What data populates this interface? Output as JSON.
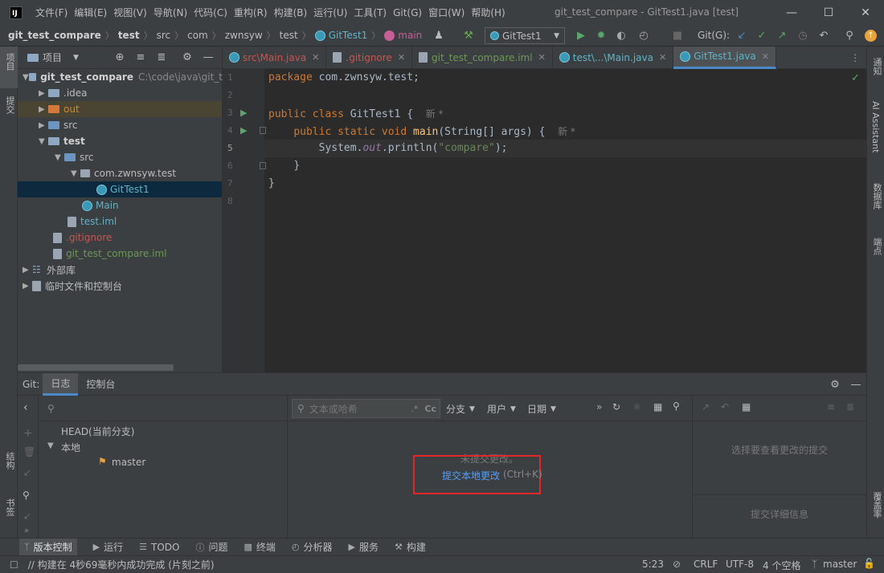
{
  "menu": [
    "文件(F)",
    "编辑(E)",
    "视图(V)",
    "导航(N)",
    "代码(C)",
    "重构(R)",
    "构建(B)",
    "运行(U)",
    "工具(T)",
    "Git(G)",
    "窗口(W)",
    "帮助(H)"
  ],
  "window_title": "git_test_compare - GitTest1.java [test]",
  "breadcrumbs": [
    "git_test_compare",
    "test",
    "src",
    "com",
    "zwnsyw",
    "test",
    "GitTest1",
    "main"
  ],
  "run_config": "GitTest1",
  "git_label": "Git(G):",
  "left_strip": {
    "project": "项目",
    "commit": "提交",
    "structure": "结构",
    "bookmarks": "书签"
  },
  "right_strip": {
    "notifications": "通知",
    "ai": "AI Assistant",
    "database": "数据库",
    "endpoints": "端点",
    "coverage": "覆盖率"
  },
  "project": {
    "header": "项目",
    "root_name": "git_test_compare",
    "root_path": "C:\\code\\java\\git_t",
    "items": [
      {
        "label": ".idea"
      },
      {
        "label": "out"
      },
      {
        "label": "src"
      },
      {
        "label": "test"
      },
      {
        "label": "src"
      },
      {
        "label": "com.zwnsyw.test"
      },
      {
        "label": "GitTest1"
      },
      {
        "label": "Main"
      },
      {
        "label": "test.iml"
      },
      {
        "label": ".gitignore"
      },
      {
        "label": "git_test_compare.iml"
      },
      {
        "label": "外部库"
      },
      {
        "label": "临时文件和控制台"
      }
    ]
  },
  "tabs": [
    {
      "label": "src\\Main.java"
    },
    {
      "label": ".gitignore"
    },
    {
      "label": "git_test_compare.iml"
    },
    {
      "label": "test\\...\\Main.java"
    },
    {
      "label": "GitTest1.java"
    }
  ],
  "code": {
    "line_numbers": [
      "1",
      "2",
      "3",
      "4",
      "5",
      "6",
      "7",
      "8"
    ],
    "package_kw": "package",
    "package_name": " com.zwnsyw.test;",
    "public": "public",
    "class": "class",
    "class_name": "GitTest1",
    "brace": " {",
    "hint_new": "新 *",
    "static": "static",
    "void": "void",
    "method": "main",
    "params": "(String[] args) {",
    "sysout_a": "System.",
    "sysout_out": "out",
    "sysout_b": ".println(",
    "string": "\"compare\"",
    "sysout_c": ");",
    "close1": "}",
    "close2": "}"
  },
  "git": {
    "label": "Git:",
    "tabs": [
      "日志",
      "控制台"
    ],
    "search_placeholder": "文本或哈希",
    "filters": [
      "分支",
      "用户",
      "日期"
    ],
    "branches": {
      "head": "HEAD(当前分支)",
      "local": "本地",
      "master": "master"
    },
    "no_commits": "未提交更改。",
    "commit_link": "提交本地更改",
    "commit_shortcut": "(Ctrl+K)",
    "select_commit": "选择要查看更改的提交",
    "commit_details": "提交详细信息"
  },
  "toolwindows": [
    "版本控制",
    "运行",
    "TODO",
    "问题",
    "终端",
    "分析器",
    "服务",
    "构建"
  ],
  "status": {
    "message": "// 构建在 4秒69毫秒内成功完成 (片刻之前)",
    "position": "5:23",
    "line_sep": "CRLF",
    "encoding": "UTF-8",
    "indent": "4 个空格",
    "branch": "master"
  }
}
